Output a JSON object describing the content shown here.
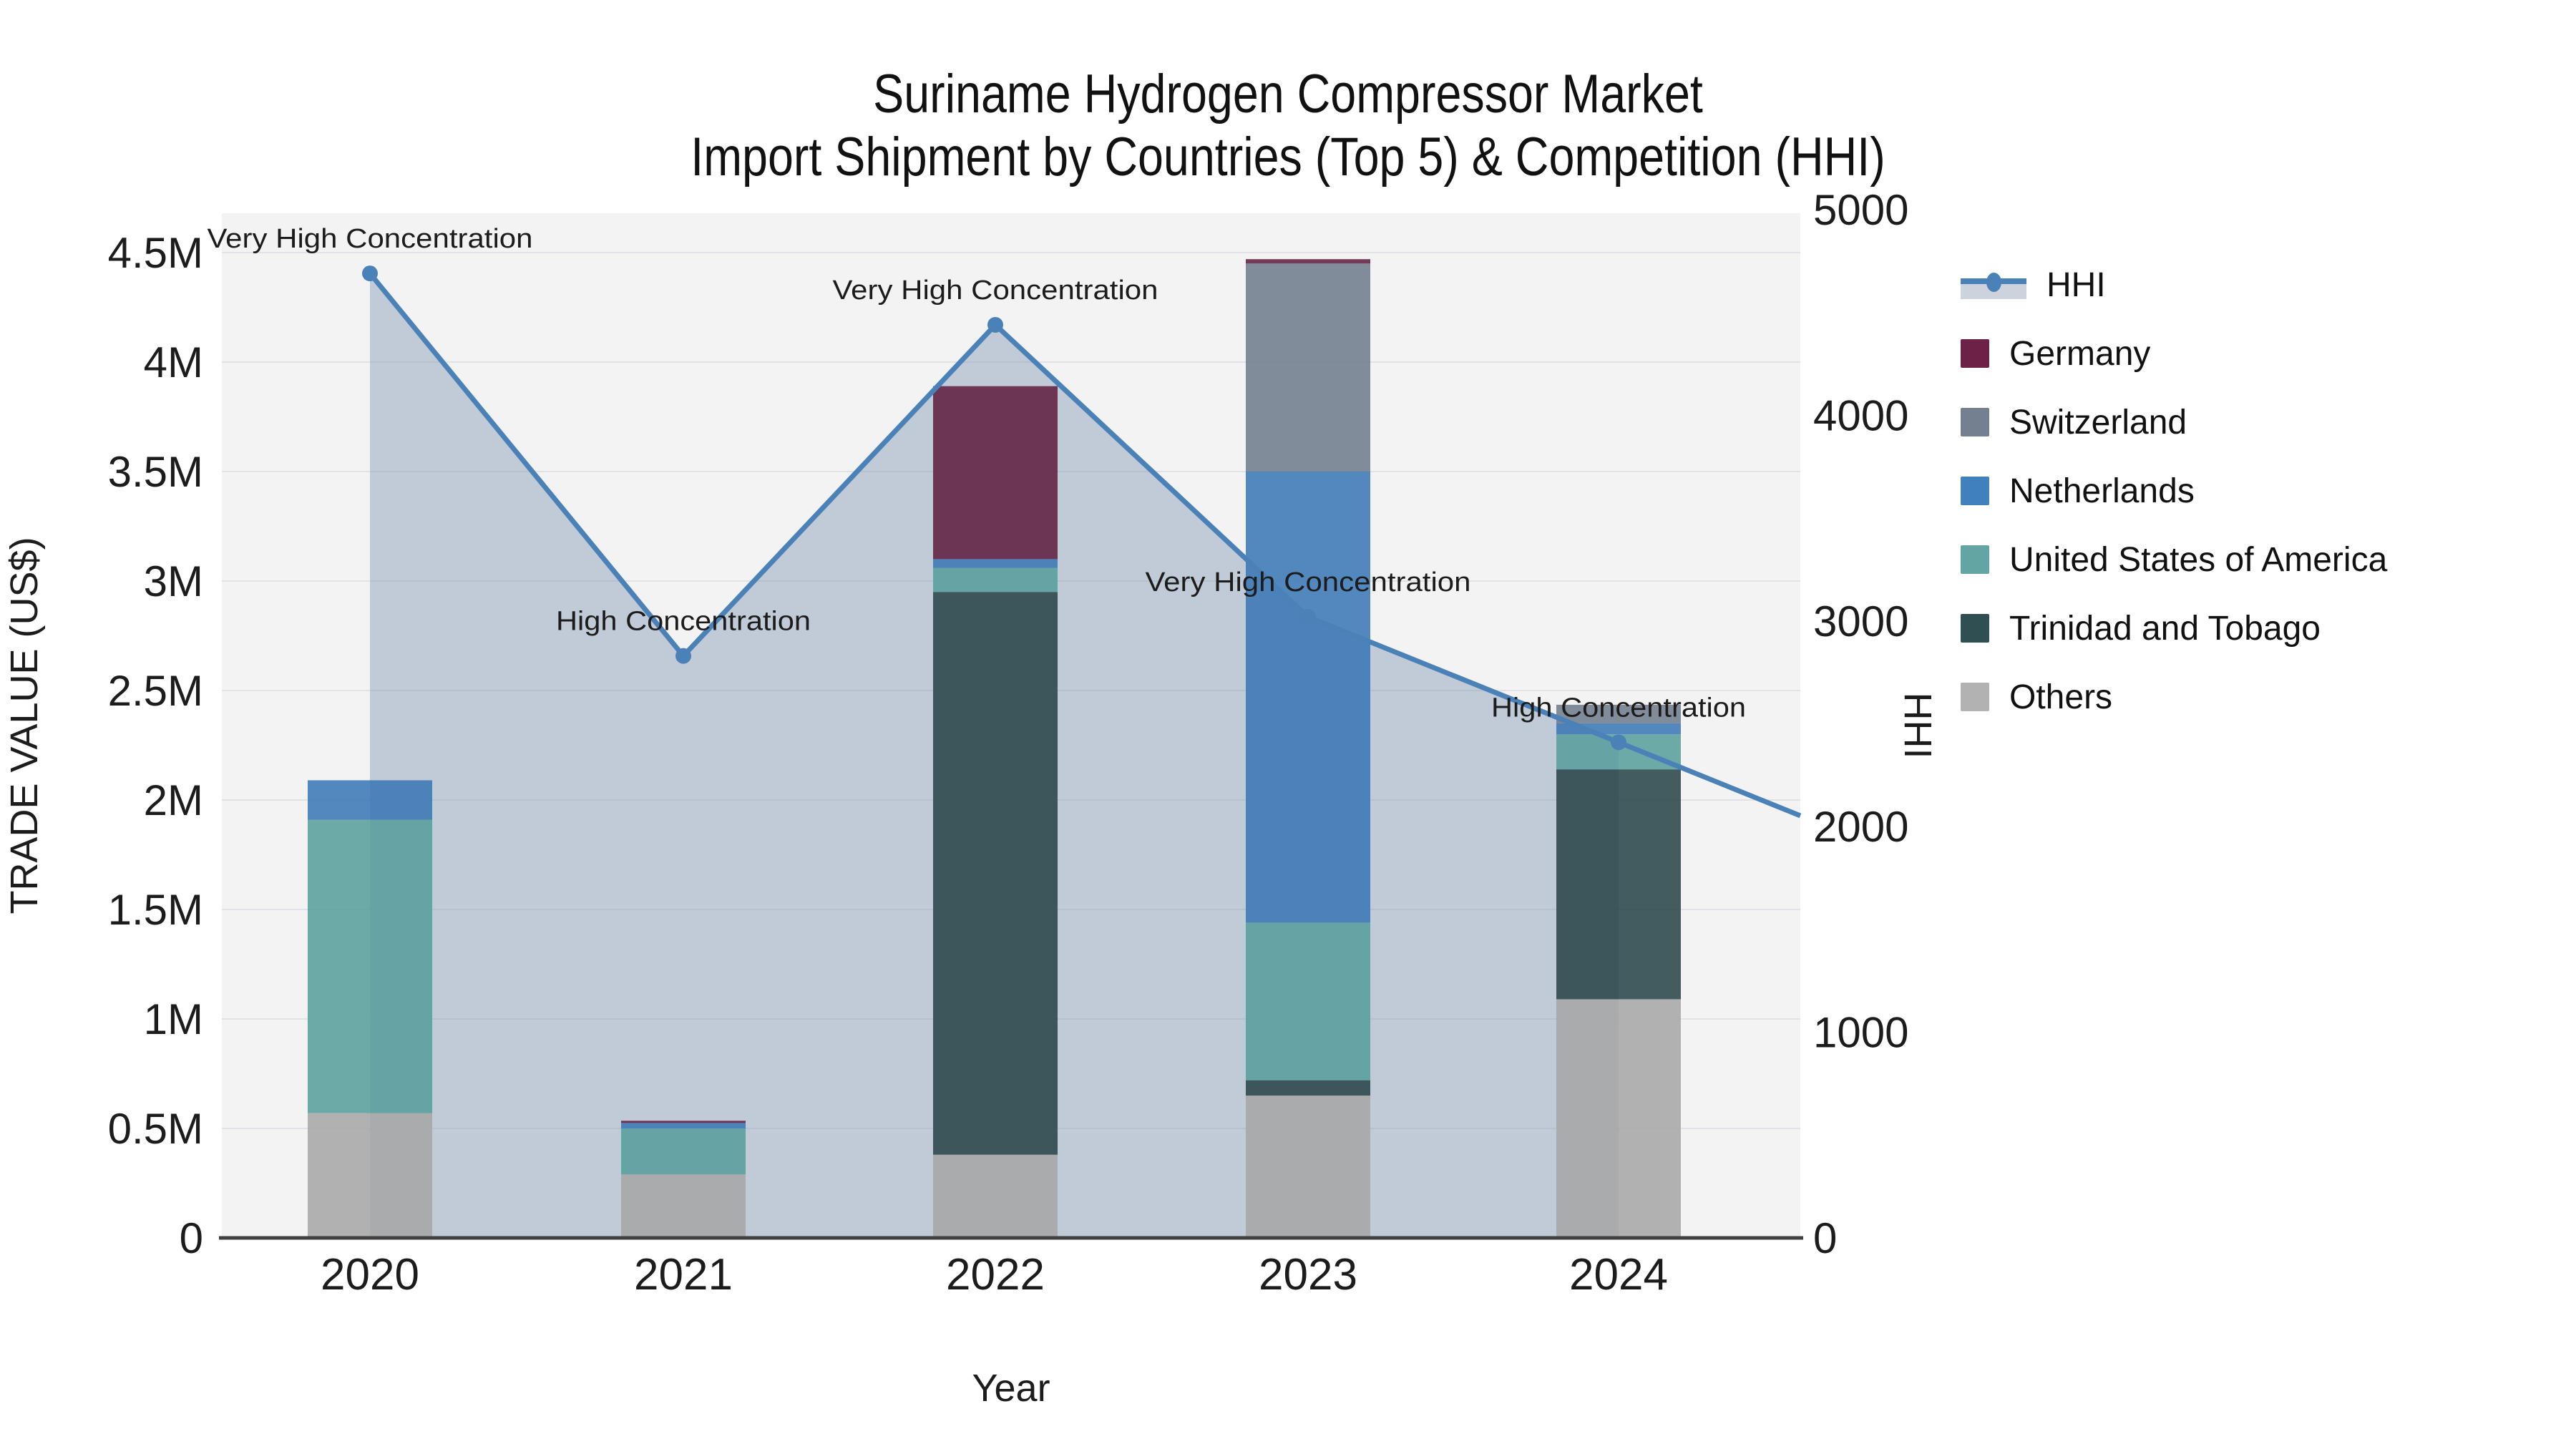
{
  "title": {
    "line1": "Suriname Hydrogen Compressor Market",
    "line2": "Import Shipment by Countries (Top 5) & Competition (HHI)"
  },
  "axes": {
    "x_title": "Year",
    "y_left_title": "TRADE VALUE (US$)",
    "y_right_title": "HHI",
    "y_left_ticks": [
      "0",
      "0.5M",
      "1M",
      "1.5M",
      "2M",
      "2.5M",
      "3M",
      "3.5M",
      "4M",
      "4.5M"
    ],
    "y_right_ticks": [
      "0",
      "1000",
      "2000",
      "3000",
      "4000",
      "5000"
    ]
  },
  "legend": {
    "items": [
      {
        "label": "HHI",
        "kind": "line",
        "color": "#4a82b8"
      },
      {
        "label": "Germany",
        "kind": "swatch",
        "color": "#6c2146"
      },
      {
        "label": "Switzerland",
        "kind": "swatch",
        "color": "#74808f"
      },
      {
        "label": "Netherlands",
        "kind": "swatch",
        "color": "#4080bd"
      },
      {
        "label": "United States of America",
        "kind": "swatch",
        "color": "#63a5a2"
      },
      {
        "label": "Trinidad and Tobago",
        "kind": "swatch",
        "color": "#2f4f53"
      },
      {
        "label": "Others",
        "kind": "swatch",
        "color": "#b2b2b2"
      }
    ]
  },
  "chart_data": {
    "type": "bar",
    "subtype": "stacked-bars-with-hhi-line-and-area",
    "title": "Suriname Hydrogen Compressor Market — Import Shipment by Countries (Top 5) & Competition (HHI)",
    "xlabel": "Year",
    "ylabel_left": "TRADE VALUE (US$)",
    "ylabel_right": "HHI",
    "categories": [
      "2020",
      "2021",
      "2022",
      "2023",
      "2024"
    ],
    "ylim_left": [
      0,
      4500000
    ],
    "ylim_right": [
      0,
      5000
    ],
    "grid": true,
    "legend_position": "right",
    "stack_order_bottom_to_top": [
      "Others",
      "Trinidad and Tobago",
      "United States of America",
      "Netherlands",
      "Switzerland",
      "Germany"
    ],
    "series": [
      {
        "name": "Germany",
        "color": "#6c2146",
        "bar_color": "#5f1f40",
        "values": [
          0,
          10000,
          790000,
          20000,
          0
        ]
      },
      {
        "name": "Switzerland",
        "color": "#74808f",
        "bar_color": "#6f7c8c",
        "values": [
          0,
          0,
          0,
          950000,
          85000
        ]
      },
      {
        "name": "Netherlands",
        "color": "#4080bd",
        "bar_color": "#3978b6",
        "values": [
          180000,
          25000,
          40000,
          2060000,
          50000
        ]
      },
      {
        "name": "United States of America",
        "color": "#63a5a2",
        "bar_color": "#579e9c",
        "values": [
          1340000,
          210000,
          110000,
          720000,
          160000
        ]
      },
      {
        "name": "Trinidad and Tobago",
        "color": "#2f4f53",
        "bar_color": "#284549",
        "values": [
          0,
          0,
          2570000,
          70000,
          1050000
        ]
      },
      {
        "name": "Others",
        "color": "#b2b2b2",
        "bar_color": "#a7a7a7",
        "values": [
          570000,
          290000,
          380000,
          650000,
          1090000
        ]
      }
    ],
    "line_series": {
      "name": "HHI",
      "color": "#4a82b8",
      "area_fill": "rgba(125,145,175,0.42)",
      "values": [
        4690,
        2830,
        4440,
        3020,
        2410
      ]
    },
    "annotations": [
      {
        "year": "2020",
        "text": "Very High Concentration"
      },
      {
        "year": "2021",
        "text": "High Concentration"
      },
      {
        "year": "2022",
        "text": "Very High Concentration"
      },
      {
        "year": "2023",
        "text": "Very High Concentration"
      },
      {
        "year": "2024",
        "text": "High Concentration"
      }
    ]
  }
}
